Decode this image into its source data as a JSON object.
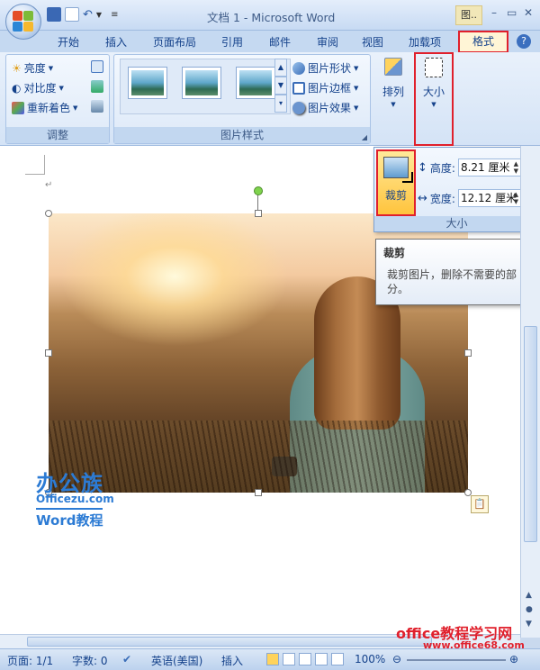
{
  "window": {
    "title": "文档 1 - Microsoft Word",
    "context_tab": "图..",
    "minimize": "–",
    "restore": "▭",
    "close": "✕"
  },
  "tabs": [
    "开始",
    "插入",
    "页面布局",
    "引用",
    "邮件",
    "审阅",
    "视图",
    "加载项",
    "格式"
  ],
  "active_tab": "格式",
  "ribbon": {
    "adjust": {
      "label": "调整",
      "brightness": "亮度",
      "contrast": "对比度",
      "recolor": "重新着色"
    },
    "picture_styles": {
      "label": "图片样式",
      "shape": "图片形状",
      "border": "图片边框",
      "effects": "图片效果"
    },
    "arrange": {
      "label": "排列"
    },
    "size": {
      "label": "大小"
    }
  },
  "size_panel": {
    "crop_label": "裁剪",
    "height_label": "高度:",
    "height_value": "8.21 厘米",
    "width_label": "宽度:",
    "width_value": "12.12 厘米",
    "group_label": "大小"
  },
  "tooltip": {
    "title": "裁剪",
    "body": "裁剪图片，删除不需要的部分。"
  },
  "watermarks": {
    "brand_cn": "办公族",
    "brand_url": "Officezu.com",
    "brand_sub": "Word教程",
    "site_cn": "office教程学习网",
    "site_url": "www.office68.com"
  },
  "statusbar": {
    "page": "页面: 1/1",
    "words": "字数: 0",
    "language": "英语(美国)",
    "mode": "插入",
    "zoom": "100%"
  },
  "colors": {
    "highlight_red": "#e0202c",
    "ribbon_text": "#15428b"
  }
}
